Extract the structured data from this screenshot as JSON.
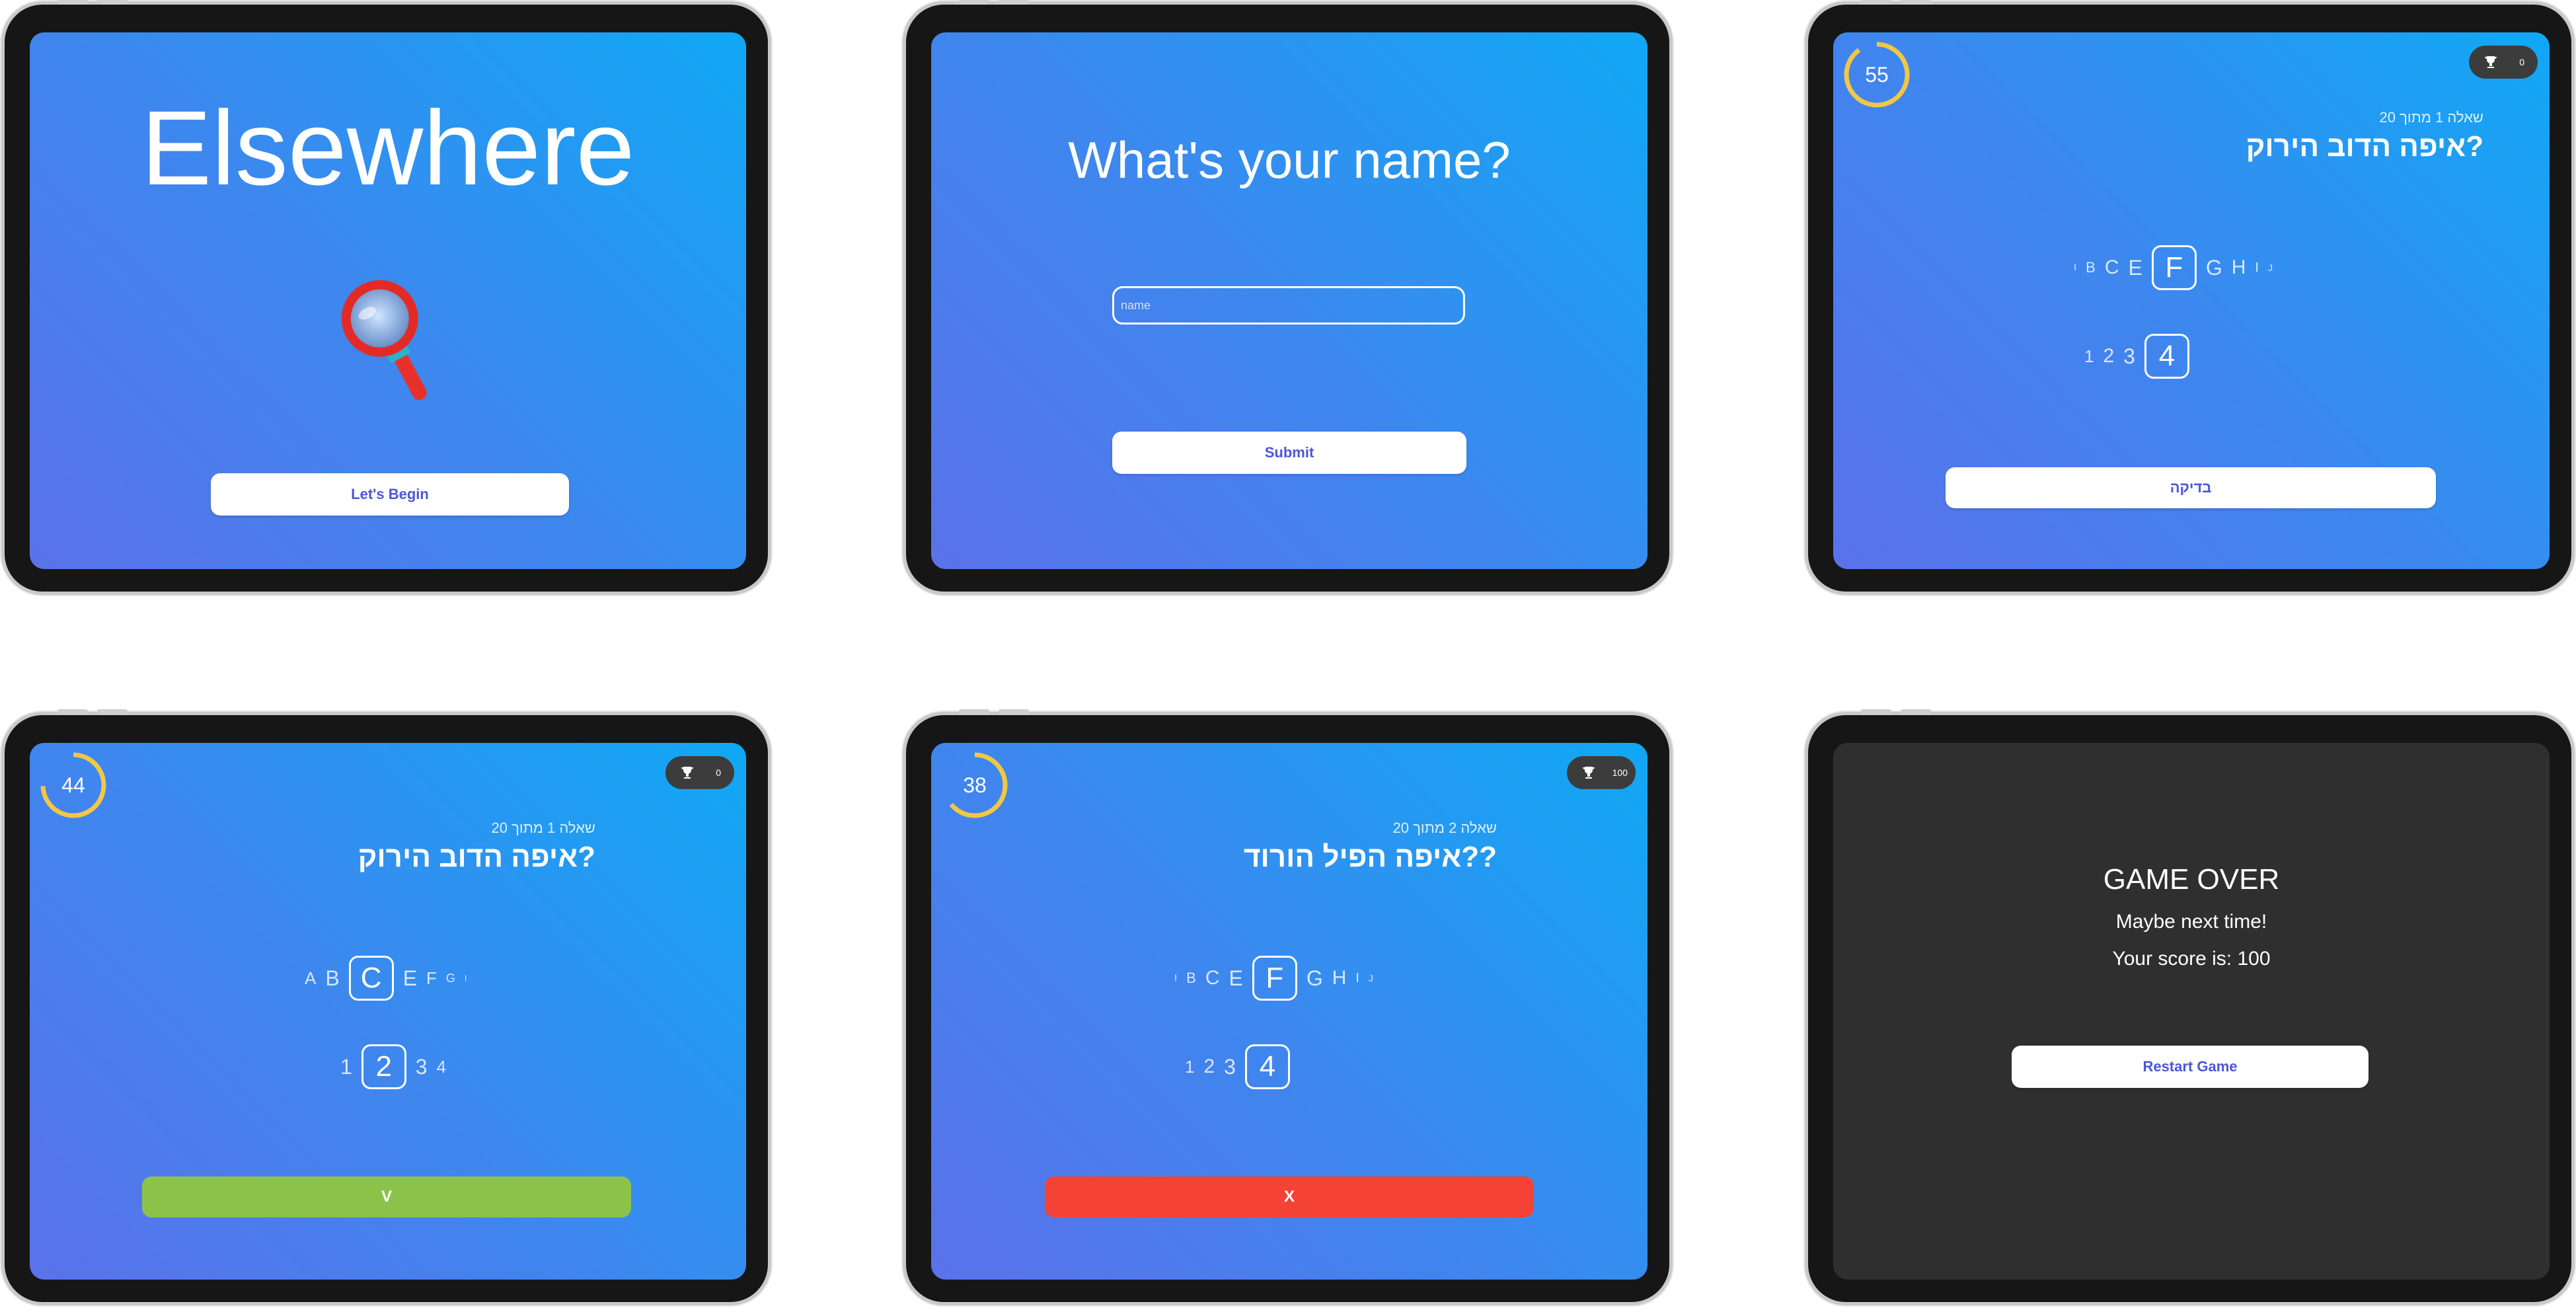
{
  "screens": {
    "splash": {
      "title": "Elsewhere",
      "begin_label": "Let's Begin"
    },
    "name": {
      "title": "What's your name?",
      "placeholder": "name",
      "submit_label": "Submit"
    },
    "q_initial": {
      "timer": "55",
      "score": "0",
      "subtitle": "שאלה 1 מתוך 20",
      "question": "?איפה הדוב הירוק",
      "letters_left": [
        "ו",
        "B",
        "C",
        "E"
      ],
      "letter_selected": "F",
      "letters_right": [
        "G",
        "H",
        "I",
        "J"
      ],
      "numbers_left": [
        "1",
        "2",
        "3"
      ],
      "number_selected": "4",
      "numbers_right": [],
      "action_label": "בדיקה"
    },
    "q_correct": {
      "timer": "44",
      "score": "0",
      "subtitle": "שאלה 1 מתוך 20",
      "question": "?איפה הדוב הירוק",
      "letters_left": [
        "A",
        "B"
      ],
      "letter_selected": "C",
      "letters_right": [
        "E",
        "F",
        "G",
        "I"
      ],
      "numbers_left": [
        "1"
      ],
      "number_selected": "2",
      "numbers_right": [
        "3",
        "4"
      ],
      "action_label": "V"
    },
    "q_wrong": {
      "timer": "38",
      "score": "100",
      "subtitle": "שאלה 2 מתוך 20",
      "question": "??איפה הפיל הורוד",
      "letters_left": [
        "ו",
        "B",
        "C",
        "E"
      ],
      "letter_selected": "F",
      "letters_right": [
        "G",
        "H",
        "I",
        "J"
      ],
      "numbers_left": [
        "1",
        "2",
        "3"
      ],
      "number_selected": "4",
      "numbers_right": [],
      "action_label": "X"
    },
    "game_over": {
      "title": "GAME OVER",
      "line1": "Maybe next time!",
      "line2": "Your score is: 100",
      "restart_label": "Restart Game"
    }
  },
  "colors": {
    "correct": "#8bc34a",
    "wrong": "#f44336",
    "button_text": "#4b56d8",
    "timer_ring": "#f2c744"
  },
  "icons": [
    "magnifying-glass-icon",
    "trophy-icon",
    "timer-ring-icon"
  ]
}
